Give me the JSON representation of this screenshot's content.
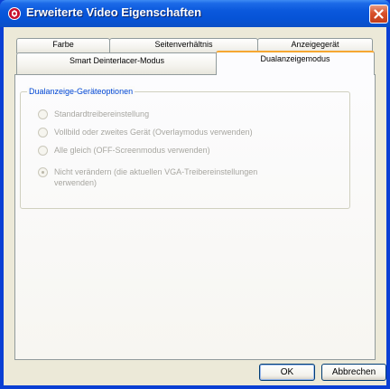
{
  "window": {
    "title": "Erweiterte Video Eigenschaften",
    "app_icon": "app-logo-icon",
    "close_icon": "close-icon"
  },
  "tabs": {
    "row_top": [
      {
        "label": "Farbe"
      },
      {
        "label": "Seitenverhältnis"
      },
      {
        "label": "Anzeigegerät"
      }
    ],
    "row_bottom": [
      {
        "label": "Smart Deinterlacer-Modus"
      },
      {
        "label": "Dualanzeigemodus",
        "active": true
      }
    ]
  },
  "group": {
    "label": "Dualanzeige-Geräteoptionen",
    "options": [
      {
        "label": "Standardtreibereinstellung",
        "selected": false
      },
      {
        "label": "Vollbild oder zweites Gerät (Overlaymodus verwenden)",
        "selected": false
      },
      {
        "label": "Alle gleich (OFF-Screenmodus verwenden)",
        "selected": false
      },
      {
        "label_line1": "Nicht verändern (die aktuellen VGA-Treibereinstellungen",
        "label_line2": "verwenden)",
        "selected": true
      }
    ]
  },
  "buttons": {
    "ok": "OK",
    "cancel": "Abbrechen"
  },
  "colors": {
    "titlebar": "#0653d6",
    "dialog_face": "#ece9d8",
    "active_tab_accent": "#f6a732",
    "group_label": "#0046d5",
    "disabled_text": "#a7a6a0"
  }
}
